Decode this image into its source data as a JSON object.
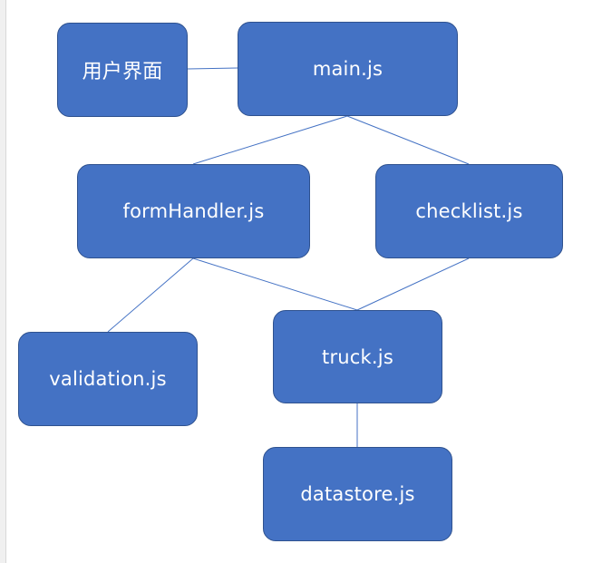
{
  "nodes": {
    "ui": "用户界面",
    "main": "main.js",
    "formHandler": "formHandler.js",
    "checklist": "checklist.js",
    "validation": "validation.js",
    "truck": "truck.js",
    "datastore": "datastore.js"
  },
  "connections": [
    [
      "ui",
      "main"
    ],
    [
      "main",
      "formHandler"
    ],
    [
      "main",
      "checklist"
    ],
    [
      "formHandler",
      "validation"
    ],
    [
      "formHandler",
      "truck"
    ],
    [
      "checklist",
      "truck"
    ],
    [
      "truck",
      "datastore"
    ]
  ],
  "colors": {
    "node_fill": "#4472c4",
    "node_border": "#2f528f",
    "edge": "#4472c4",
    "text": "#ffffff"
  }
}
